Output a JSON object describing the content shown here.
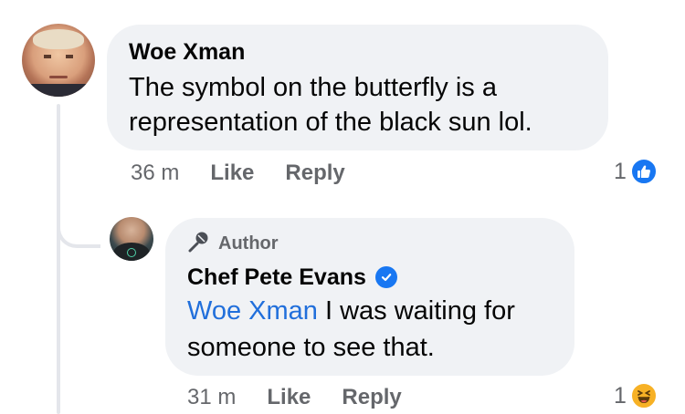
{
  "comment": {
    "author": "Woe Xman",
    "lines": [
      "The symbol on the butterfly is a",
      "representation of the black sun lol."
    ],
    "time": "36 m",
    "like_label": "Like",
    "reply_label": "Reply",
    "reaction_count": "1",
    "reaction_icon": "like-icon",
    "reaction_color": "#1877f2"
  },
  "reply": {
    "badge": "Author",
    "author": "Chef Pete Evans",
    "verified_icon": "verified-badge-icon",
    "mention": "Woe Xman",
    "line1_rest": " I was waiting for",
    "line2": "someone to see that.",
    "time": "31 m",
    "like_label": "Like",
    "reply_label": "Reply",
    "reaction_count": "1",
    "reaction_icon": "haha-icon",
    "reaction_color": "#f7b125"
  },
  "colors": {
    "bubble": "#f0f2f5",
    "meta_text": "#65676b",
    "link": "#216fdb",
    "accent": "#1877f2"
  }
}
